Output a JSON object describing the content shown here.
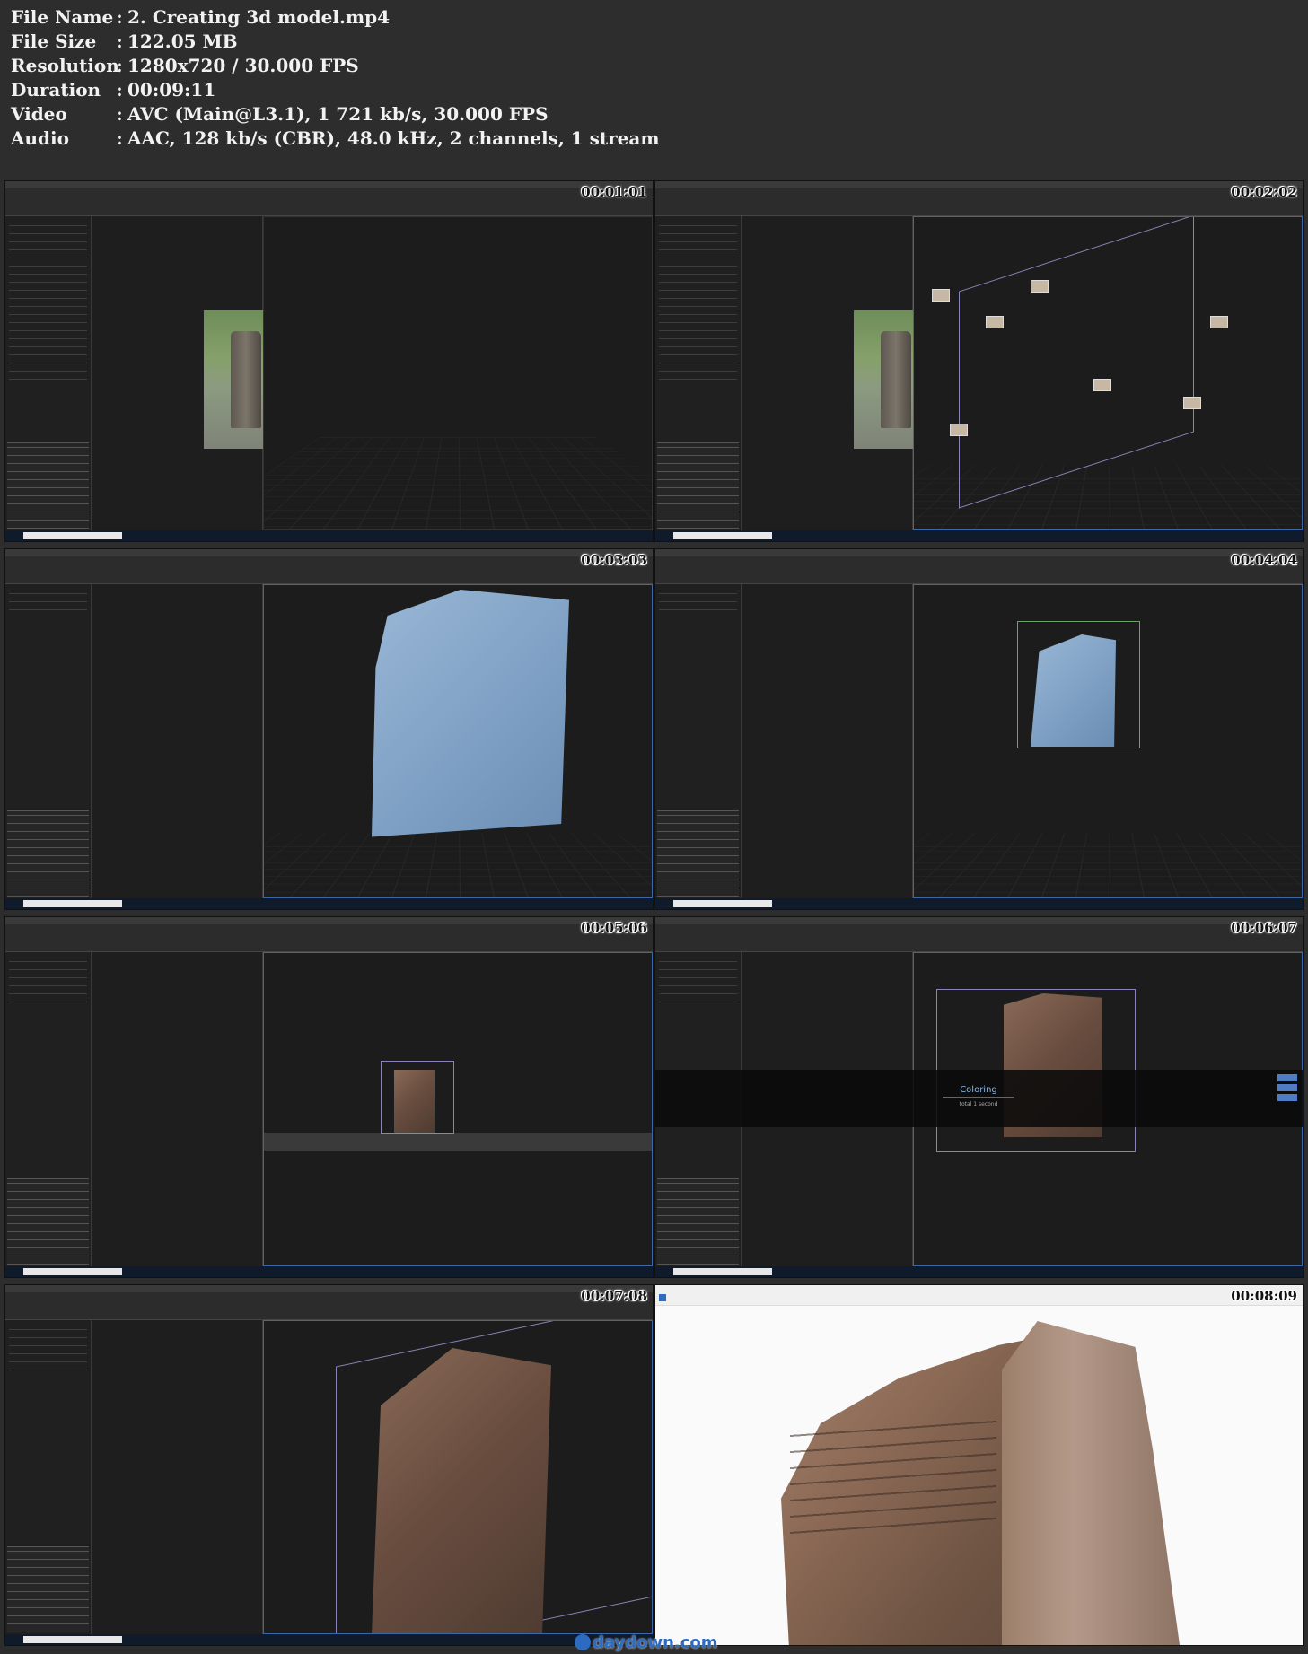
{
  "info": [
    {
      "key": "File Name",
      "value": "2. Creating 3d model.mp4"
    },
    {
      "key": "File Size",
      "value": "122.05 MB"
    },
    {
      "key": "Resolution",
      "value": "1280x720 / 30.000 FPS"
    },
    {
      "key": "Duration",
      "value": "00:09:11"
    },
    {
      "key": "Video",
      "value": "AVC (Main@L3.1), 1 721 kb/s, 30.000 FPS"
    },
    {
      "key": "Audio",
      "value": "AAC, 128 kb/s (CBR), 48.0 kHz, 2 channels, 1 stream"
    }
  ],
  "separator": ":",
  "thumbnails": [
    {
      "timecode": "00:01:01",
      "scene": "image-view"
    },
    {
      "timecode": "00:02:02",
      "scene": "alignment"
    },
    {
      "timecode": "00:03:03",
      "scene": "mesh-closeup"
    },
    {
      "timecode": "00:04:04",
      "scene": "mesh-box"
    },
    {
      "timecode": "00:05:06",
      "scene": "textured-small"
    },
    {
      "timecode": "00:06:07",
      "scene": "coloring"
    },
    {
      "timecode": "00:07:08",
      "scene": "textured-closeup"
    },
    {
      "timecode": "00:08:09",
      "scene": "viewer"
    }
  ],
  "coloring": {
    "label": "Coloring",
    "sub": "total 1 second"
  },
  "watermark": "daydown.com",
  "colors": {
    "viewport_border": "#3a68a8",
    "accent": "#2d6bc0"
  }
}
